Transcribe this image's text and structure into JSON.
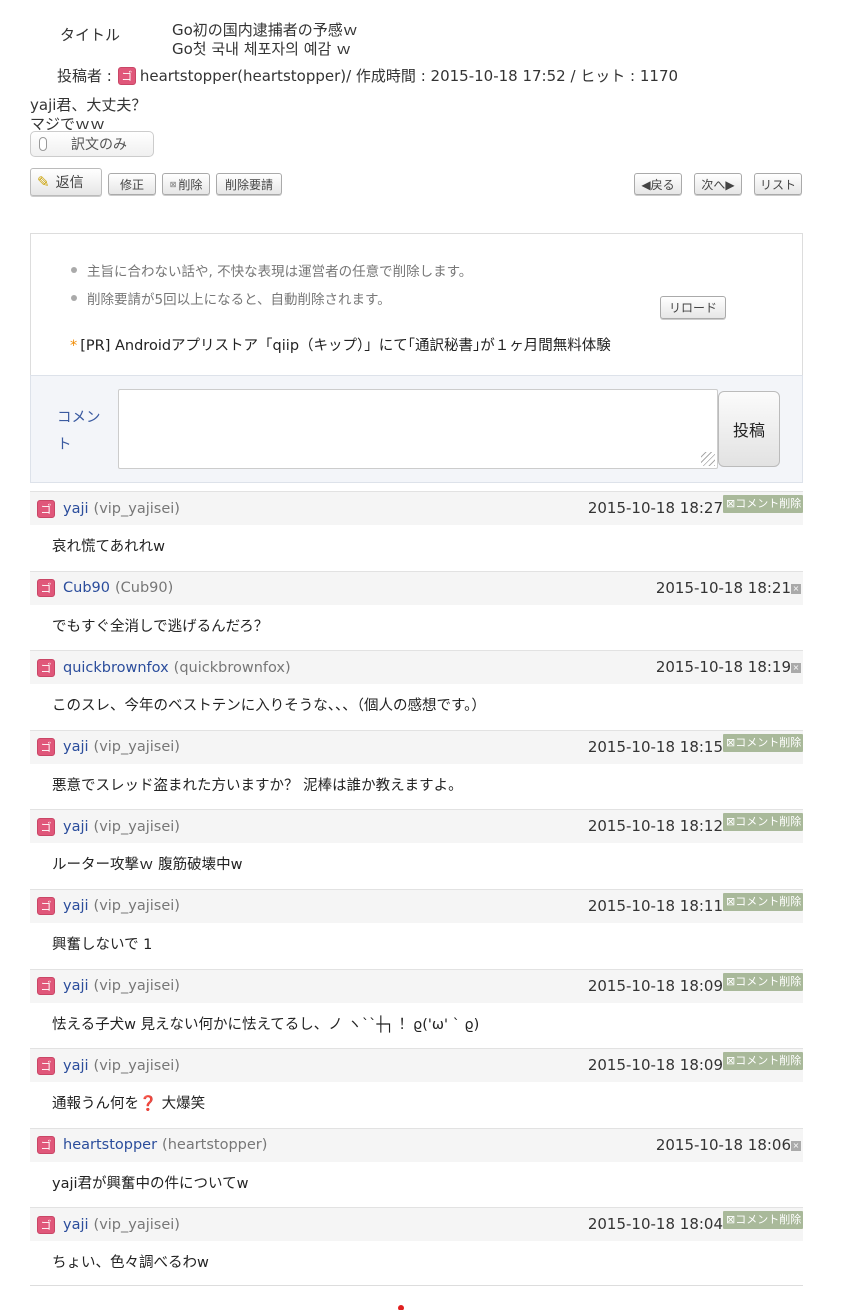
{
  "header": {
    "title_label": "タイトル",
    "title_ja": "Go初の国内逮捕者の予感ｗ",
    "title_ko": "Go첫 국내 체포자의 예감 ｗ",
    "poster_label": "投稿者 :",
    "poster": "heartstopper(heartstopper)",
    "meta_rest": " / 作成時間 : 2015-10-18 17:52 / ヒット : 1170",
    "user_icon": "ゴ"
  },
  "body": {
    "line1": "yaji君、大丈夫？",
    "line2": "マジでｗｗ",
    "toggle_label": "訳文のみ"
  },
  "actions": {
    "reply": "返信",
    "edit": "修正",
    "delete": "削除",
    "delete_request": "削除要請",
    "prev": "◀戻る",
    "next": "次へ▶",
    "list": "リスト"
  },
  "notice": {
    "items": [
      "主旨に合わない話や, 不快な表現は運営者の任意で削除します。",
      "削除要請が5回以上になると、自動削除されます。"
    ],
    "reload": "リロード",
    "pr": "[PR] Androidアプリストア「qiip（キップ）」にて｢通訳秘書｣が１ヶ月間無料体験"
  },
  "comment_form": {
    "label": "コメント",
    "submit": "投稿"
  },
  "comment_delete_label": "コメント削除",
  "comments": [
    {
      "name": "yaji",
      "id": "(vip_yajisei)",
      "date": "2015-10-18 18:27",
      "text": "哀れ慌てあれれw",
      "deletable": true
    },
    {
      "name": "Cub90",
      "id": "(Cub90)",
      "date": "2015-10-18 18:21",
      "text": "でもすぐ全消しで逃げるんだろ？",
      "deletable": false
    },
    {
      "name": "quickbrownfox",
      "id": "(quickbrownfox)",
      "date": "2015-10-18 18:19",
      "text": "このスレ、今年のベストテンに入りそうな、、、（個人の感想です。）",
      "deletable": false
    },
    {
      "name": "yaji",
      "id": "(vip_yajisei)",
      "date": "2015-10-18 18:15",
      "text": "悪意でスレッド盗まれた方いますか？ 泥棒は誰か教えますよ。",
      "deletable": true
    },
    {
      "name": "yaji",
      "id": "(vip_yajisei)",
      "date": "2015-10-18 18:12",
      "text": "ルーター攻撃ｗ 腹筋破壊中w",
      "deletable": true
    },
    {
      "name": "yaji",
      "id": "(vip_yajisei)",
      "date": "2015-10-18 18:11",
      "text": "興奮しないで 1",
      "deletable": true
    },
    {
      "name": "yaji",
      "id": "(vip_yajisei)",
      "date": "2015-10-18 18:09",
      "text": "怯える子犬w 見えない何かに怯えてるし、ノ ヽ``┼┐ ！ϱ('ω' ` ϱ)",
      "deletable": true
    },
    {
      "name": "yaji",
      "id": "(vip_yajisei)",
      "date": "2015-10-18 18:09",
      "text_pre": "通報うん何を",
      "text_mark": "❓",
      "text_post": " 大爆笑",
      "deletable": true
    },
    {
      "name": "heartstopper",
      "id": "(heartstopper)",
      "date": "2015-10-18 18:06",
      "text": "yaji君が興奮中の件についてw",
      "deletable": false
    },
    {
      "name": "yaji",
      "id": "(vip_yajisei)",
      "date": "2015-10-18 18:04",
      "text": "ちょい、色々調べるわw",
      "deletable": true
    }
  ]
}
